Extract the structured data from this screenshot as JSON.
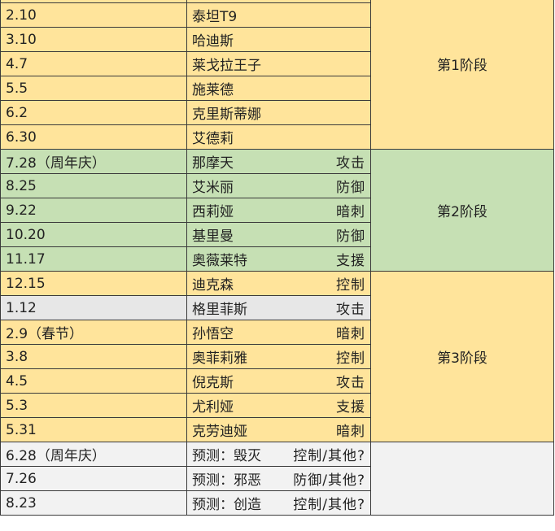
{
  "rows": [
    {
      "date": "",
      "name": "",
      "role": "",
      "bg": "y",
      "pred": false
    },
    {
      "date": "2.10",
      "name": "泰坦T9",
      "role": "",
      "bg": "y",
      "pred": false
    },
    {
      "date": "3.10",
      "name": "哈迪斯",
      "role": "",
      "bg": "y",
      "pred": false
    },
    {
      "date": "4.7",
      "name": "莱戈拉王子",
      "role": "",
      "bg": "y",
      "pred": false
    },
    {
      "date": "5.5",
      "name": "施莱德",
      "role": "",
      "bg": "y",
      "pred": false
    },
    {
      "date": "6.2",
      "name": "克里斯蒂娜",
      "role": "",
      "bg": "y",
      "pred": false
    },
    {
      "date": "6.30",
      "name": "艾德莉",
      "role": "",
      "bg": "y",
      "pred": false
    },
    {
      "date": "7.28（周年庆）",
      "name": "那摩天",
      "role": "攻击",
      "bg": "g",
      "pred": false
    },
    {
      "date": "8.25",
      "name": "艾米丽",
      "role": "防御",
      "bg": "g",
      "pred": false
    },
    {
      "date": "9.22",
      "name": "西莉娅",
      "role": "暗刺",
      "bg": "g",
      "pred": false
    },
    {
      "date": "10.20",
      "name": "基里曼",
      "role": "防御",
      "bg": "g",
      "pred": false
    },
    {
      "date": "11.17",
      "name": "奥薇莱特",
      "role": "支援",
      "bg": "g",
      "pred": false
    },
    {
      "date": "12.15",
      "name": "迪克森",
      "role": "控制",
      "bg": "y",
      "pred": false
    },
    {
      "date": "1.12",
      "name": "格里菲斯",
      "role": "攻击",
      "bg": "gr",
      "pred": false
    },
    {
      "date": "2.9（春节）",
      "name": "孙悟空",
      "role": "暗刺",
      "bg": "y",
      "pred": false
    },
    {
      "date": "3.8",
      "name": "奥菲莉雅",
      "role": "控制",
      "bg": "y",
      "pred": false
    },
    {
      "date": "4.5",
      "name": "倪克斯",
      "role": "攻击",
      "bg": "y",
      "pred": false
    },
    {
      "date": "5.3",
      "name": "尤利娅",
      "role": "支援",
      "bg": "y",
      "pred": false
    },
    {
      "date": "5.31",
      "name": "克劳迪娅",
      "role": "暗刺",
      "bg": "y",
      "pred": false
    },
    {
      "date": "6.28（周年庆）",
      "prefix": "预测：",
      "name": "毁灭",
      "role": "控制/其他?",
      "bg": "lt",
      "pred": true
    },
    {
      "date": "7.26",
      "prefix": "预测：",
      "name": "邪恶",
      "role": "防御/其他?",
      "bg": "lt",
      "pred": true
    },
    {
      "date": "8.23",
      "prefix": "预测：",
      "name": "创造",
      "role": "控制/其他?",
      "bg": "lt",
      "pred": true
    }
  ],
  "phases": [
    {
      "label": "第1阶段",
      "start": 0,
      "span": 7,
      "bg": "y"
    },
    {
      "label": "第2阶段",
      "start": 7,
      "span": 5,
      "bg": "g"
    },
    {
      "label": "第3阶段",
      "start": 12,
      "span": 7,
      "bg": "y"
    },
    {
      "label": "",
      "start": 19,
      "span": 3,
      "bg": "lt"
    }
  ]
}
